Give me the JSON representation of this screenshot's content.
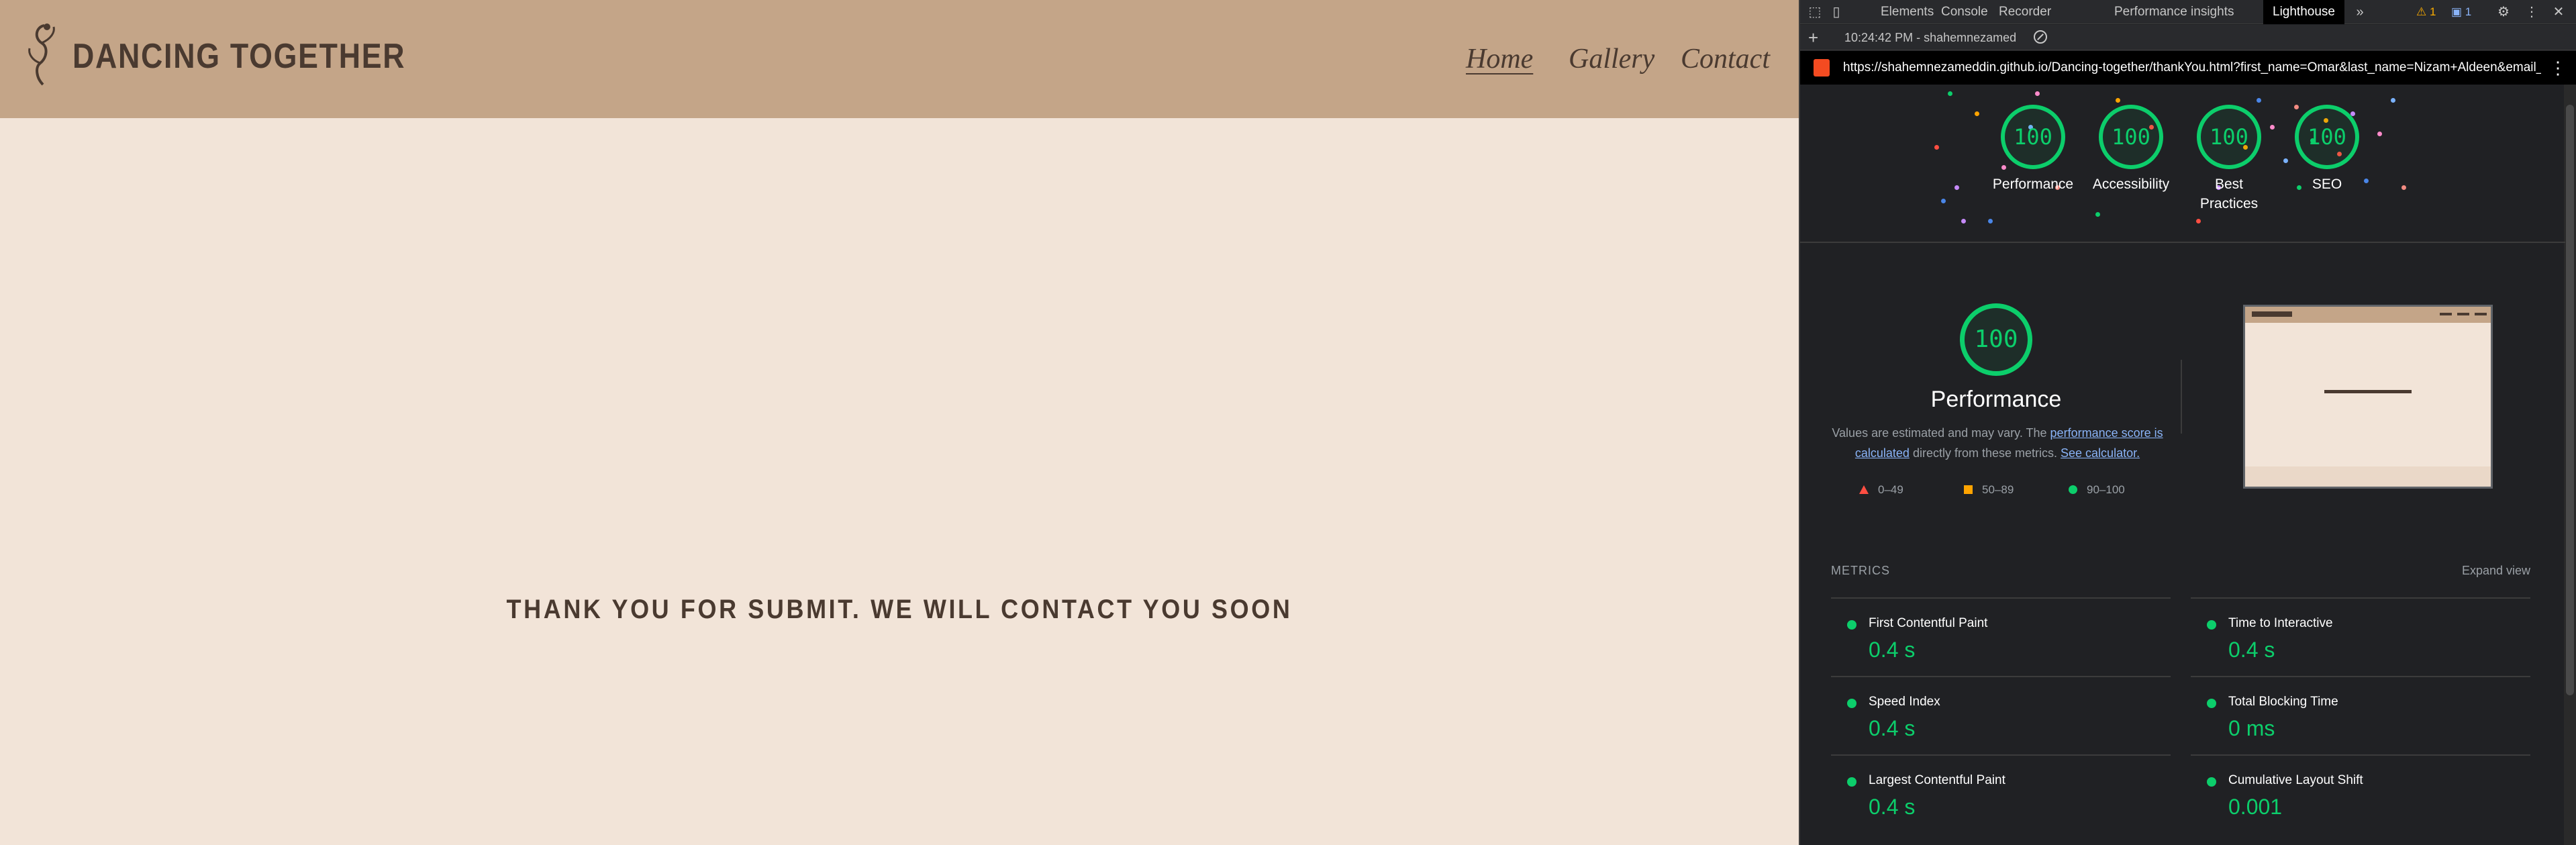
{
  "site": {
    "brand": "DANCING TOGETHER",
    "logo_icon": "dancer-logo-icon",
    "nav": {
      "home": "Home",
      "gallery": "Gallery",
      "contact": "Contact"
    },
    "message": "THANK YOU FOR SUBMIT. WE WILL CONTACT YOU SOON"
  },
  "devtools": {
    "tabs": [
      "Elements",
      "Console",
      "Recorder",
      "Performance insights",
      "Lighthouse"
    ],
    "active_tab": "Lighthouse",
    "more_tabs_icon": "chevron-double-right-icon",
    "warnings_count": "1",
    "messages_count": "1",
    "run_time": "10:24:42 PM - shahemnezamed",
    "url": "https://shahemnezameddin.github.io/Dancing-together/thankYou.html?first_name=Omar&last_name=Nizam+Aldeen&email_add...",
    "gauges": [
      {
        "score": "100",
        "label": "Performance"
      },
      {
        "score": "100",
        "label": "Accessibility"
      },
      {
        "score": "100",
        "label": "Best Practices"
      },
      {
        "score": "100",
        "label": "SEO"
      }
    ],
    "performance": {
      "score": "100",
      "title": "Performance",
      "desc_prefix": "Values are estimated and may vary. The ",
      "desc_link": "performance score is calculated",
      "desc_middle": " directly from these metrics. ",
      "desc_link2": "See calculator.",
      "legend": {
        "fail": "0–49",
        "average": "50–89",
        "pass": "90–100"
      }
    },
    "metrics_header": "METRICS",
    "expand_label": "Expand view",
    "metrics": [
      {
        "name": "First Contentful Paint",
        "value": "0.4 s"
      },
      {
        "name": "Time to Interactive",
        "value": "0.4 s"
      },
      {
        "name": "Speed Index",
        "value": "0.4 s"
      },
      {
        "name": "Total Blocking Time",
        "value": "0 ms"
      },
      {
        "name": "Largest Contentful Paint",
        "value": "0.4 s"
      },
      {
        "name": "Cumulative Layout Shift",
        "value": "0.001"
      }
    ],
    "colors": {
      "pass": "#0cce6b",
      "average": "#ffa400",
      "fail": "#ff4e42",
      "link": "#8ab4f8"
    }
  }
}
